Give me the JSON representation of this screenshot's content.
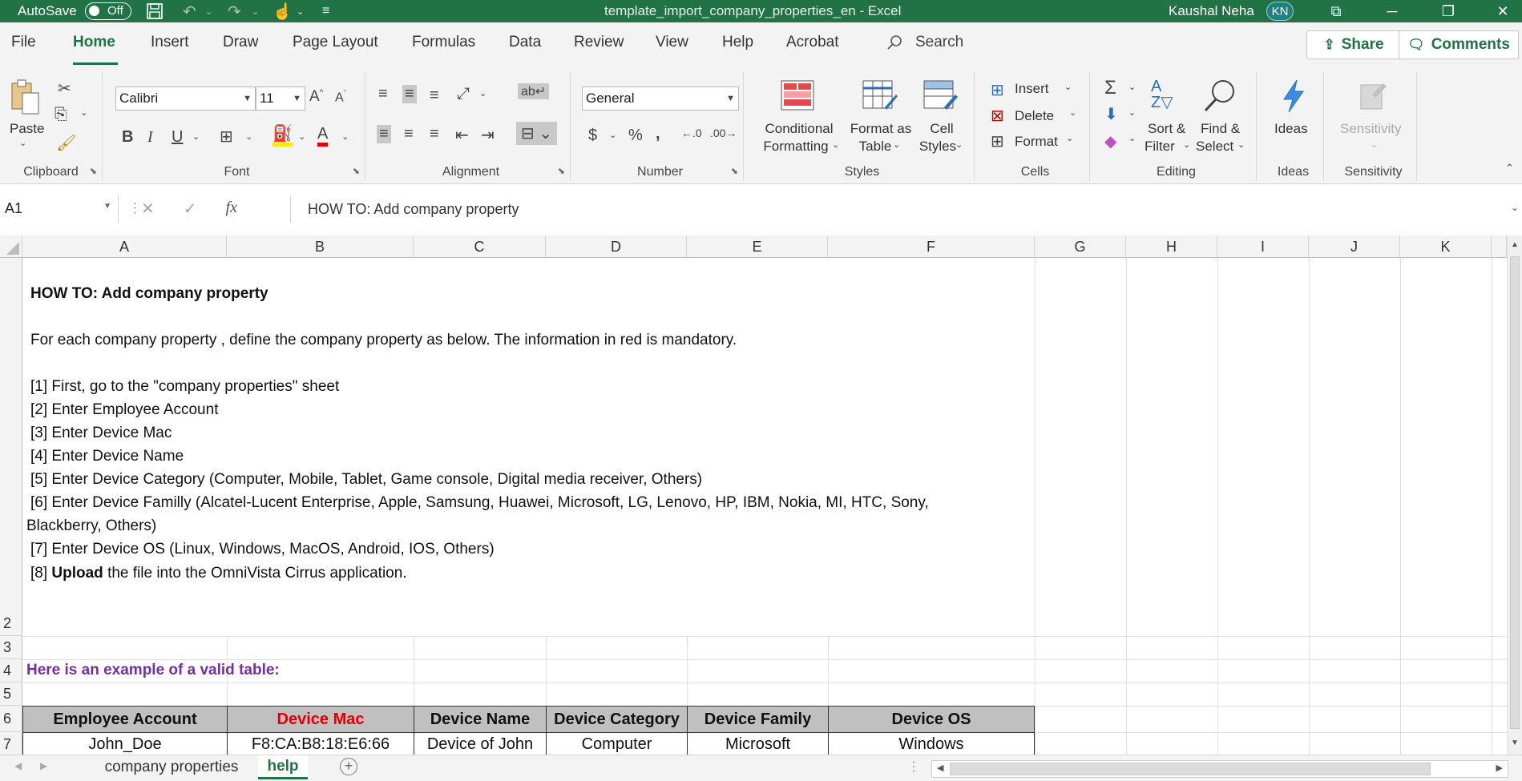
{
  "titlebar": {
    "autosave_label": "AutoSave",
    "autosave_state": "Off",
    "document_title": "template_import_company_properties_en  -  Excel",
    "user_name": "Kaushal Neha",
    "user_initials": "KN"
  },
  "tabs": [
    "File",
    "Home",
    "Insert",
    "Draw",
    "Page Layout",
    "Formulas",
    "Data",
    "Review",
    "View",
    "Help",
    "Acrobat"
  ],
  "search_label": "Search",
  "share_label": "Share",
  "comments_label": "Comments",
  "ribbon": {
    "clipboard": {
      "paste": "Paste",
      "label": "Clipboard"
    },
    "font": {
      "family": "Calibri",
      "size": "11",
      "label": "Font"
    },
    "alignment": {
      "label": "Alignment"
    },
    "number": {
      "format": "General",
      "label": "Number"
    },
    "styles": {
      "conditional_formatting_1": "Conditional",
      "conditional_formatting_2": "Formatting",
      "format_as_table_1": "Format as",
      "format_as_table_2": "Table",
      "cell_styles_1": "Cell",
      "cell_styles_2": "Styles",
      "label": "Styles"
    },
    "cells": {
      "insert": "Insert",
      "delete": "Delete",
      "format": "Format",
      "label": "Cells"
    },
    "editing": {
      "sort_filter_1": "Sort &",
      "sort_filter_2": "Filter",
      "find_select_1": "Find &",
      "find_select_2": "Select",
      "label": "Editing"
    },
    "ideas": {
      "button": "Ideas",
      "label": "Ideas"
    },
    "sensitivity": {
      "button": "Sensitivity",
      "label": "Sensitivity"
    }
  },
  "formula_bar": {
    "name_box": "A1",
    "formula": "HOW TO: Add company property"
  },
  "columns": [
    "A",
    "B",
    "C",
    "D",
    "E",
    "F",
    "G",
    "H",
    "I",
    "J",
    "K"
  ],
  "rows": [
    "2",
    "3",
    "4",
    "5",
    "6",
    "7"
  ],
  "instructions": {
    "title": "HOW TO: Add company property",
    "intro": "For each company property , define the company property as below.  The information in red is mandatory.",
    "step1": "[1] First, go to the \"company properties\" sheet",
    "step2": "[2] Enter Employee Account",
    "step3": "[3] Enter Device Mac",
    "step4": "[4] Enter Device Name",
    "step5": "[5] Enter Device Category (Computer, Mobile, Tablet, Game console, Digital media receiver, Others)",
    "step6a": "[6] Enter Device Familly (Alcatel-Lucent Enterprise, Apple, Samsung, Huawei, Microsoft, LG, Lenovo, HP, IBM, Nokia, MI, HTC, Sony,",
    "step6b": "Blackberry, Others)",
    "step7": "[7] Enter Device OS (Linux, Windows, MacOS, Android, IOS, Others)",
    "step8_prefix": "[8] ",
    "step8_bold": "Upload",
    "step8_suffix": " the file into the OmniVista Cirrus application."
  },
  "example_label": "Here is an example of a valid table:",
  "example_table": {
    "headers": [
      "Employee Account",
      "Device Mac",
      "Device Name",
      "Device Category",
      "Device Family",
      "Device OS"
    ],
    "row": [
      "John_Doe",
      "F8:CA:B8:18:E6:66",
      "Device of John",
      "Computer",
      "Microsoft",
      "Windows"
    ]
  },
  "sheet_tabs": [
    "company properties",
    "help"
  ],
  "active_sheet": "help",
  "colors": {
    "excel_green": "#217346",
    "mandatory_red": "#e00000",
    "example_purple": "#7030a0",
    "header_gray": "#c0c0c0"
  }
}
